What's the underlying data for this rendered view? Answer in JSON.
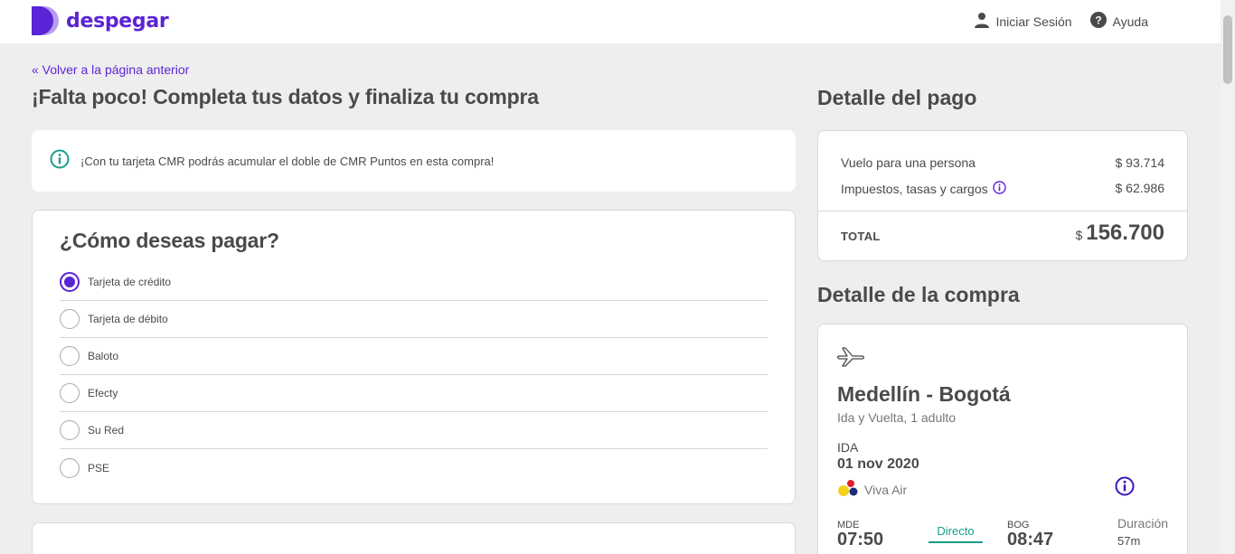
{
  "header": {
    "brand": "despegar",
    "login_label": "Iniciar Sesión",
    "help_label": "Ayuda"
  },
  "nav": {
    "back_label": "« Volver a la página anterior"
  },
  "page_title": "¡Falta poco! Completa tus datos y finaliza tu compra",
  "info_banner": {
    "text": "¡Con tu tarjeta CMR podrás acumular el doble de CMR Puntos en esta compra!"
  },
  "payment": {
    "title": "¿Cómo deseas pagar?",
    "options": [
      {
        "label": "Tarjeta de crédito",
        "selected": true
      },
      {
        "label": "Tarjeta de débito",
        "selected": false
      },
      {
        "label": "Baloto",
        "selected": false
      },
      {
        "label": "Efecty",
        "selected": false
      },
      {
        "label": "Su Red",
        "selected": false
      },
      {
        "label": "PSE",
        "selected": false
      }
    ]
  },
  "payment_detail": {
    "title": "Detalle del pago",
    "rows": [
      {
        "label": "Vuelo para una persona",
        "value": "$ 93.714"
      },
      {
        "label": "Impuestos, tasas y cargos",
        "value": "$ 62.986"
      }
    ],
    "total_label": "TOTAL",
    "total_currency": "$",
    "total_amount": "156.700"
  },
  "purchase_detail": {
    "title": "Detalle de la compra",
    "route": "Medellín - Bogotá",
    "trip_type": "Ida y Vuelta, 1 adulto",
    "leg_label": "IDA",
    "date": "01 nov 2020",
    "airline": "Viva Air",
    "origin_code": "MDE",
    "origin_time": "07:50",
    "stops_label": "Directo",
    "dest_code": "BOG",
    "dest_time": "08:47",
    "duration_label": "Duración",
    "duration_value": "57m"
  },
  "colors": {
    "brand": "#5b24d6",
    "teal": "#1a9e8c",
    "background": "#eeeeee"
  }
}
